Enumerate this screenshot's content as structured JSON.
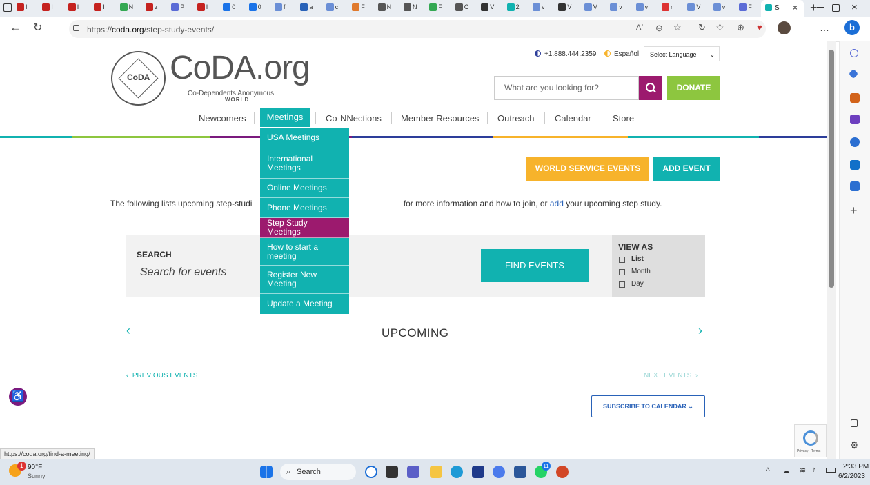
{
  "browser": {
    "tabs": [
      "I",
      "I",
      "I",
      "I",
      "N",
      "z",
      "P",
      "I",
      "0",
      "0",
      "f",
      "a",
      "c",
      "F",
      "N",
      "N",
      "F",
      "C",
      "V",
      "2",
      "v",
      "V",
      "V",
      "v",
      "v",
      "r",
      "V",
      "v",
      "F"
    ],
    "active_tab": "S",
    "url_prefix": "https://",
    "url_domain": "coda.org",
    "url_path": "/step-study-events/",
    "read_aloud": "Aʾ",
    "more": "…"
  },
  "site": {
    "logo_title": "CoDA.org",
    "logo_subtitle": "Co-Dependents Anonymous",
    "logo_world": "WORLD",
    "seal_text": "CoDA",
    "phone": "+1.888.444.2359",
    "espanol": "Español",
    "language_select": "Select Language",
    "search_placeholder": "What are you looking for?",
    "donate": "DONATE"
  },
  "nav": {
    "items": [
      "Newcomers",
      "Meetings",
      "Co-NNections",
      "Member Resources",
      "Outreach",
      "Calendar",
      "Store"
    ],
    "dropdown": [
      "USA Meetings",
      "International Meetings",
      "Online Meetings",
      "Phone Meetings",
      "Step Study Meetings",
      "How to start a meeting",
      "Register New Meeting",
      "Update a Meeting"
    ]
  },
  "buttons": {
    "world_service": "WORLD SERVICE EVENTS",
    "add_event": "ADD EVENT"
  },
  "intro": {
    "before": "The following lists upcoming step-studi",
    "after": " for more information and how to join, or ",
    "link": "add",
    "end": " your upcoming step study."
  },
  "events": {
    "search_label": "SEARCH",
    "search_placeholder": "Search for events",
    "find_events": "FIND EVENTS",
    "view_as": "VIEW AS",
    "view_options": [
      "List",
      "Month",
      "Day"
    ],
    "upcoming": "UPCOMING",
    "prev": "PREVIOUS EVENTS",
    "next": "NEXT EVENTS",
    "subscribe": "SUBSCRIBE TO CALENDAR"
  },
  "status_url": "https://coda.org/find-a-meeting/",
  "recaptcha_text": "Privacy - Terms",
  "taskbar": {
    "weather_temp": "90°F",
    "weather_desc": "Sunny",
    "search_label": "Search",
    "time": "2:33 PM",
    "date": "6/2/2023",
    "badge": "1",
    "whatsapp_badge": "11"
  },
  "colors": {
    "teal": "#11b2b0",
    "magenta": "#9c1a6e",
    "orange": "#f7b32b",
    "green": "#8dc63f",
    "blue": "#2962b8"
  }
}
